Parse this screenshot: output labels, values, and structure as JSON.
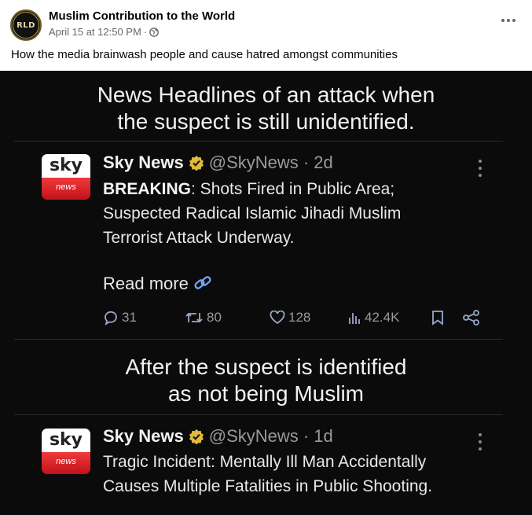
{
  "post": {
    "avatar_text": "RLD",
    "page_name": "Muslim Contribution to the World",
    "timestamp": "April 15 at 12:50 PM",
    "separator": "·",
    "caption": "How the media brainwash people and cause hatred amongst communities"
  },
  "image": {
    "headline_1_line1": "News Headlines of an attack when",
    "headline_1_line2": "the suspect is still unidentified.",
    "headline_2_line1": "After the suspect is identified",
    "headline_2_line2": "as not being Muslim",
    "tweet_1": {
      "logo_top": "sky",
      "logo_bottom": "news",
      "name": "Sky News",
      "handle": "@SkyNews · 2d",
      "body_bold": "BREAKING",
      "body_line1_rest": ": Shots Fired in Public Area;",
      "body_line2": "Suspected Radical Islamic Jihadi Muslim",
      "body_line3": "Terrorist Attack Underway.",
      "read_more": "Read more",
      "replies": "31",
      "retweets": "80",
      "likes": "128",
      "views": "42.4K"
    },
    "tweet_2": {
      "logo_top": "sky",
      "logo_bottom": "news",
      "name": "Sky News",
      "handle": "@SkyNews · 1d",
      "body_line1": "Tragic Incident: Mentally Ill Man Accidentally",
      "body_line2": "Causes Multiple Fatalities in Public Shooting."
    }
  },
  "colors": {
    "background": "#0b0b0c",
    "link": "#7aa7ff",
    "verified": "#e2b93b",
    "sky_red": "#d9232b"
  }
}
